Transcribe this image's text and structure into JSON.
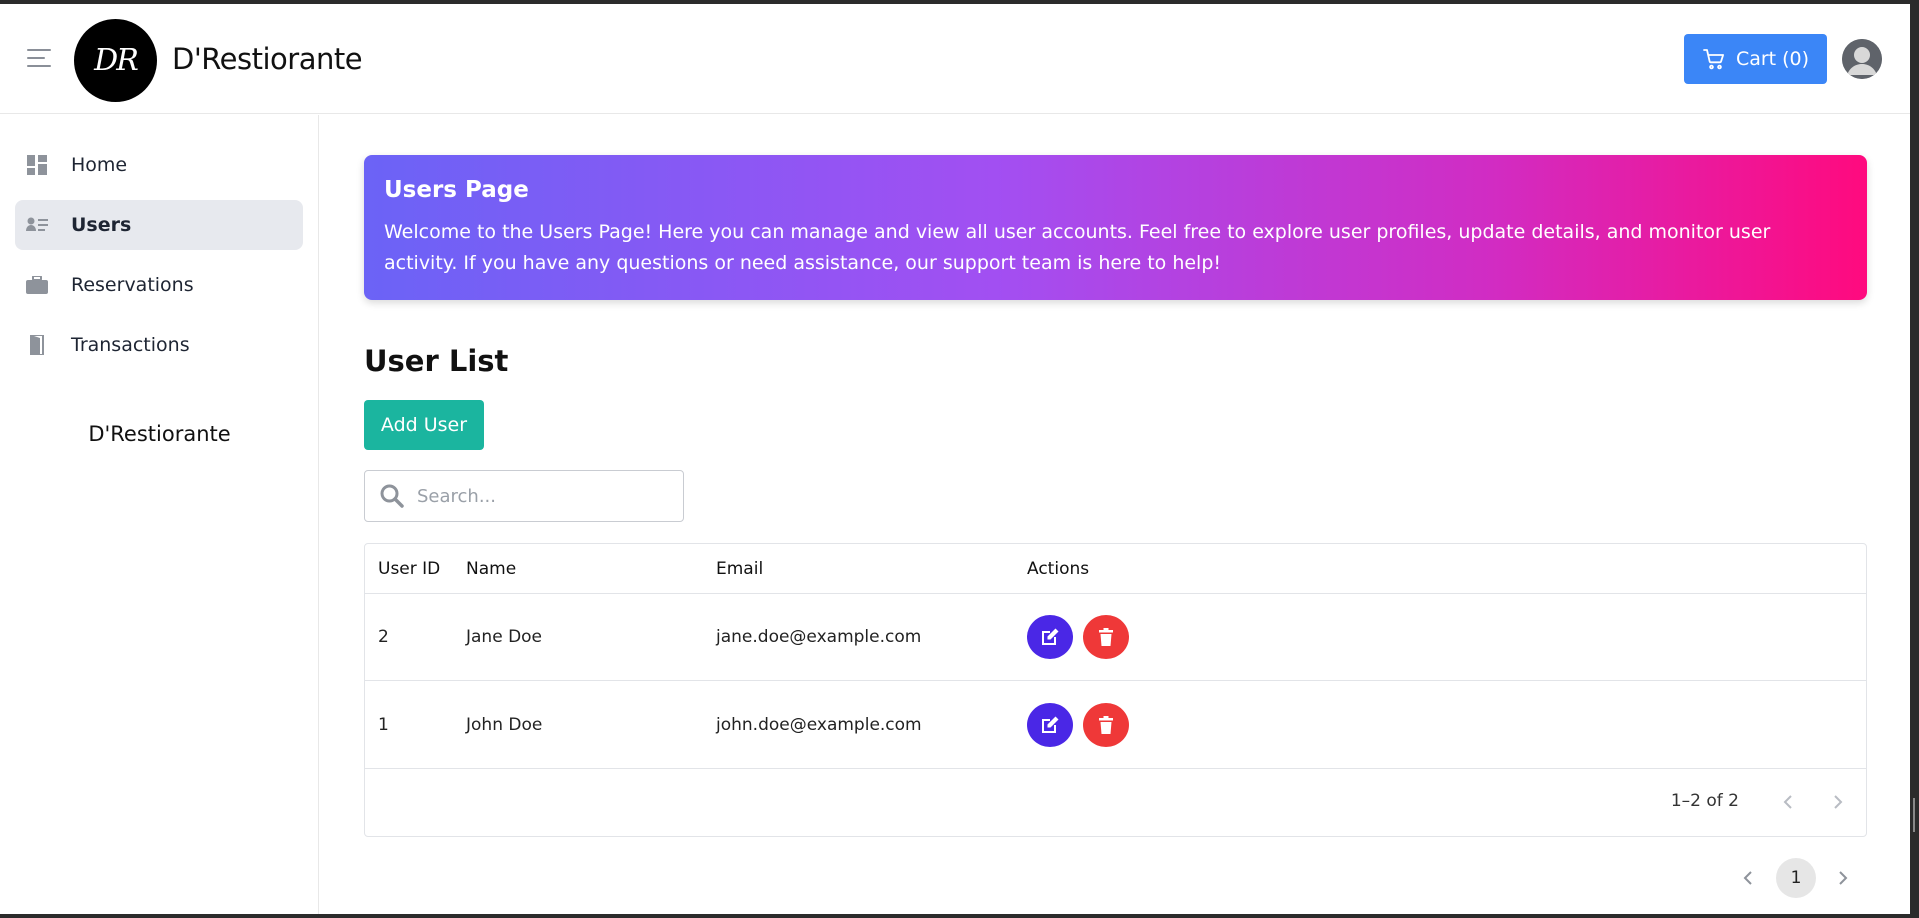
{
  "header": {
    "logo_text": "DR",
    "brand": "D'Restiorante",
    "cart_label": "Cart (0)"
  },
  "sidebar": {
    "items": [
      {
        "label": "Home",
        "icon": "dashboard-icon",
        "active": false
      },
      {
        "label": "Users",
        "icon": "users-list-icon",
        "active": true
      },
      {
        "label": "Reservations",
        "icon": "briefcase-icon",
        "active": false
      },
      {
        "label": "Transactions",
        "icon": "door-icon",
        "active": false
      }
    ],
    "brand": "D'Restiorante"
  },
  "banner": {
    "title": "Users Page",
    "text": "Welcome to the Users Page! Here you can manage and view all user accounts. Feel free to explore user profiles, update details, and monitor user activity. If you have any questions or need assistance, our support team is here to help!"
  },
  "main": {
    "section_title": "User List",
    "add_button": "Add User",
    "search_placeholder": "Search..."
  },
  "table": {
    "columns": [
      "User ID",
      "Name",
      "Email",
      "Actions"
    ],
    "rows": [
      {
        "id": "2",
        "name": "Jane Doe",
        "email": "jane.doe@example.com"
      },
      {
        "id": "1",
        "name": "John Doe",
        "email": "john.doe@example.com"
      }
    ],
    "range": "1–2 of 2"
  },
  "pagination": {
    "current_page": "1"
  },
  "colors": {
    "cart": "#3b86f7",
    "add": "#1bb59f",
    "edit": "#4a27e6",
    "delete": "#ef3838",
    "banner_start": "#6b63f6",
    "banner_end": "#ff0a7e"
  }
}
